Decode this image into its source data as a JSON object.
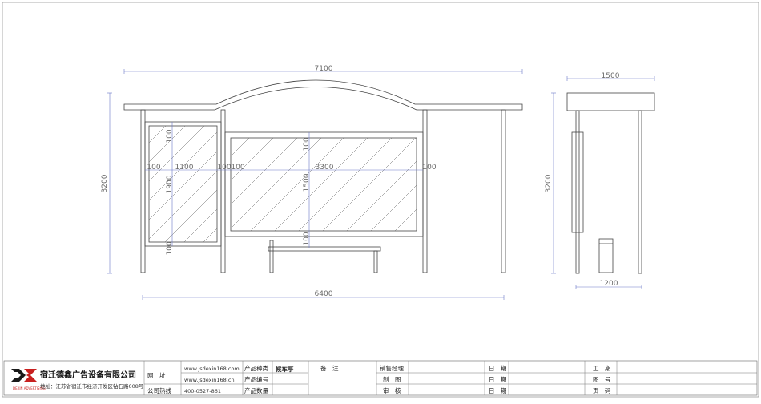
{
  "overall_width_front": "7100",
  "overall_height_front": "3200",
  "bottom_width_front": "6400",
  "panel_left": {
    "side_left": "100",
    "width": "1100",
    "side_right": "100",
    "top": "100",
    "height": "1900",
    "bottom": "100"
  },
  "panel_main": {
    "side_left": "100",
    "width": "3300",
    "side_right": "100",
    "top": "100",
    "height": "1500",
    "bottom": "100"
  },
  "side_view": {
    "top_width": "1500",
    "height": "3200",
    "bottom_width": "1200"
  },
  "title_block": {
    "company_name": "宿迁德鑫广告设备有限公司",
    "address": "地址：江苏省宿迁市经济开发区钻石路008号",
    "logo_subtext": "DEXIN ADVERTISING",
    "website_label": "网　址",
    "website_1": "www.jsdexin168.com",
    "website_2": "www.jsdexin168.cn",
    "hotline_label": "公司热线",
    "hotline": "400-0527-861",
    "product_type_label": "产品种类",
    "product_type_value": "候车亭",
    "product_code_label": "产品编号",
    "product_qty_label": "产品数量",
    "remarks_label": "备　注",
    "sales_manager_label": "销售经理",
    "drawing_label": "制　图",
    "review_label": "审　核",
    "date_label_1": "日　期",
    "date_label_2": "日　期",
    "date_label_3": "日　期",
    "period_label": "工　期",
    "drawing_no_label": "图　号",
    "page_label": "页　码"
  }
}
